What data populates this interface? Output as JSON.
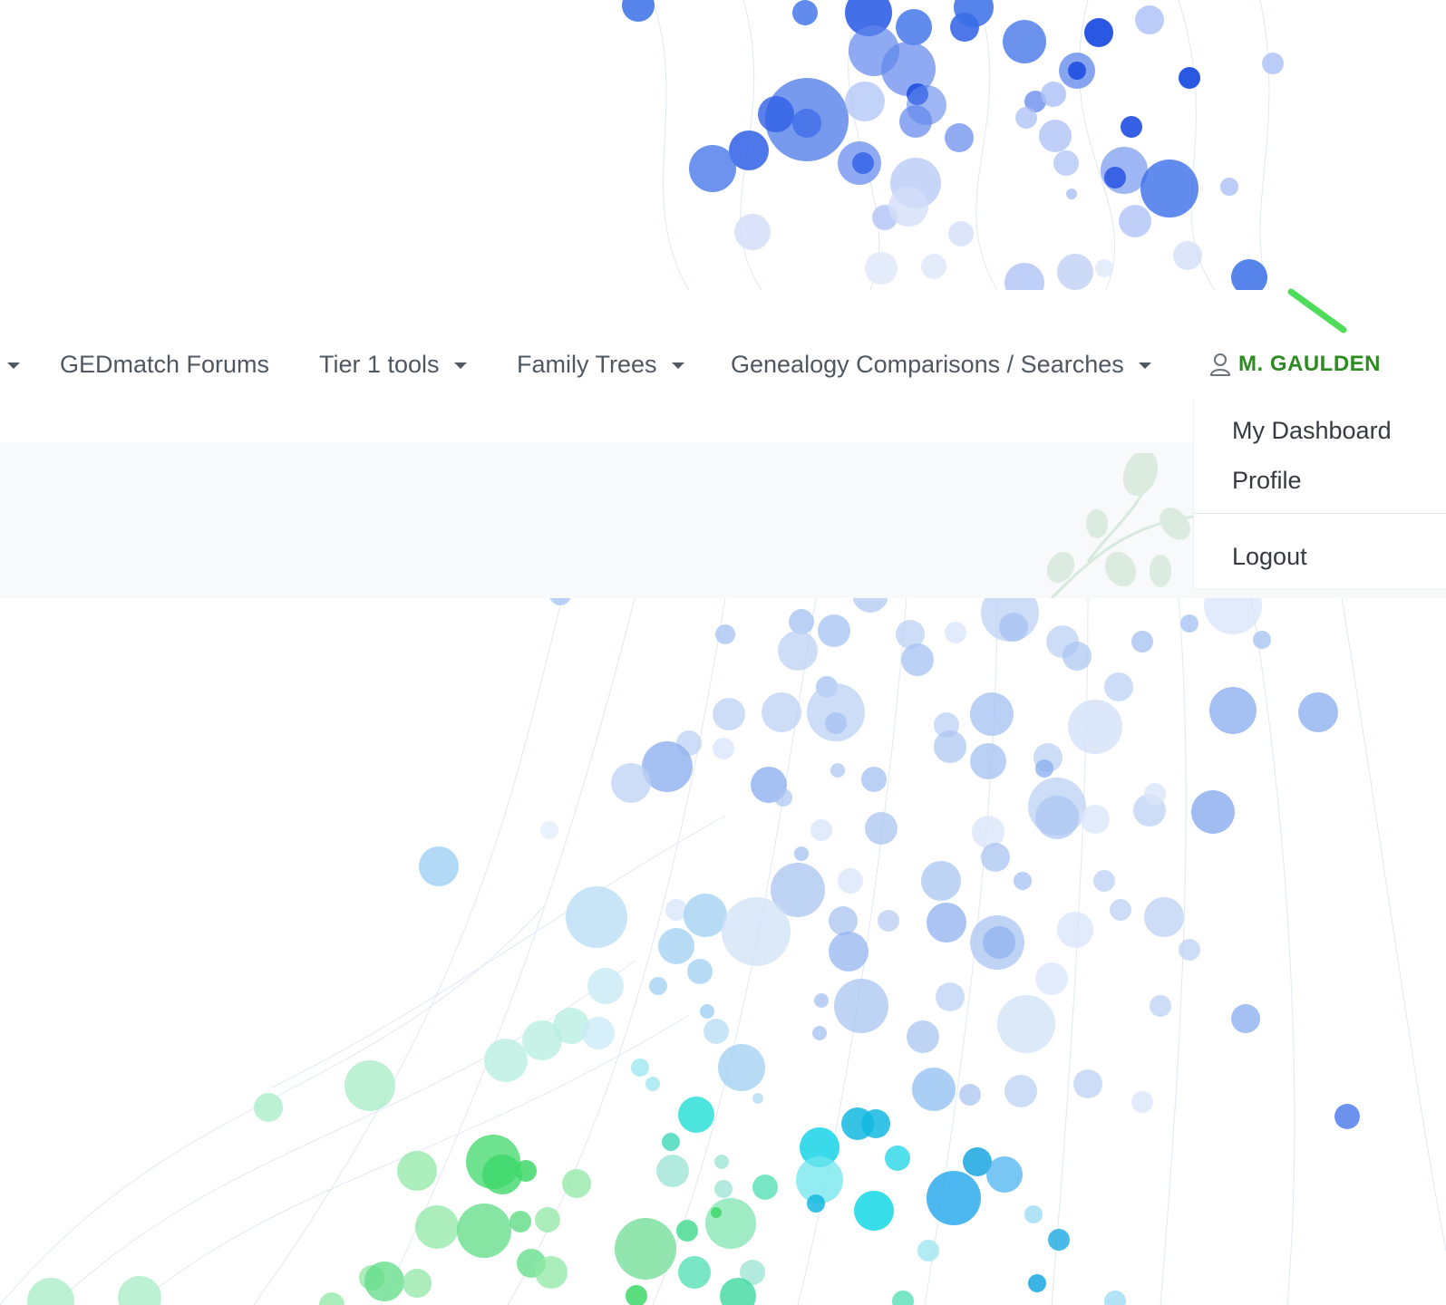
{
  "nav": {
    "items": [
      {
        "label": "GEDmatch Forums",
        "has_caret": false
      },
      {
        "label": "Tier 1 tools",
        "has_caret": true
      },
      {
        "label": "Family Trees",
        "has_caret": true
      },
      {
        "label": "Genealogy Comparisons / Searches",
        "has_caret": true
      }
    ],
    "user": {
      "icon": "user-icon",
      "name": "M. GAULDEN",
      "color": "#2e8b22"
    }
  },
  "user_menu": {
    "items": [
      {
        "label": "My Dashboard"
      },
      {
        "label": "Profile"
      },
      {
        "label": "Logout"
      }
    ]
  },
  "colors": {
    "text": "#4f5860",
    "accent_green": "#2e8b22",
    "subbar_bg": "#f8f9fa",
    "bubble_blue": "#3a6fe8",
    "bubble_cyan": "#19d3e6",
    "bubble_green": "#3fd86a"
  }
}
